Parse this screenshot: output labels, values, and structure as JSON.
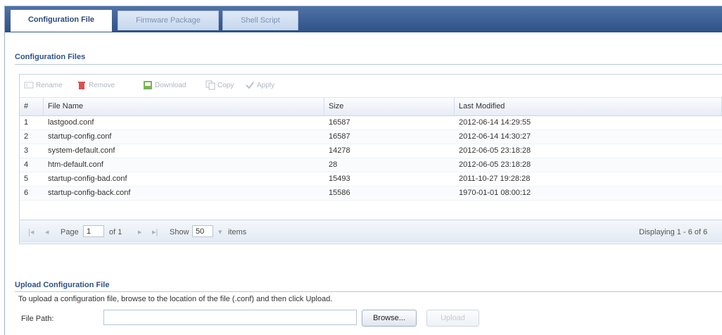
{
  "tabs": [
    {
      "label": "Configuration File",
      "active": true
    },
    {
      "label": "Firmware Package",
      "active": false
    },
    {
      "label": "Shell Script",
      "active": false
    }
  ],
  "config_section": {
    "title": "Configuration Files"
  },
  "toolbar": {
    "rename": "Rename",
    "remove": "Remove",
    "download": "Download",
    "copy": "Copy",
    "apply": "Apply"
  },
  "table": {
    "headers": [
      "#",
      "File Name",
      "Size",
      "Last Modified"
    ],
    "rows": [
      {
        "num": "1",
        "name": "lastgood.conf",
        "size": "16587",
        "modified": "2012-06-14 14:29:55"
      },
      {
        "num": "2",
        "name": "startup-config.conf",
        "size": "16587",
        "modified": "2012-06-14 14:30:27"
      },
      {
        "num": "3",
        "name": "system-default.conf",
        "size": "14278",
        "modified": "2012-06-05 23:18:28"
      },
      {
        "num": "4",
        "name": "htm-default.conf",
        "size": "28",
        "modified": "2012-06-05 23:18:28"
      },
      {
        "num": "5",
        "name": "startup-config-bad.conf",
        "size": "15493",
        "modified": "2011-10-27 19:28:28"
      },
      {
        "num": "6",
        "name": "startup-config-back.conf",
        "size": "15586",
        "modified": "1970-01-01 08:00:12"
      }
    ]
  },
  "pager": {
    "page_label": "Page",
    "page_value": "1",
    "of_label": "of 1",
    "show_label": "Show",
    "show_value": "50",
    "items_label": "items",
    "displaying": "Displaying 1 - 6 of 6"
  },
  "upload_section": {
    "title": "Upload Configuration File",
    "description": "To upload a configuration file, browse to the location of the file (.conf) and then click Upload.",
    "file_path_label": "File Path:",
    "browse_label": "Browse...",
    "upload_label": "Upload"
  },
  "colors": {
    "tab_bar": "#3a5d93",
    "section_title": "#2e5287",
    "remove_icon": "#d9534f",
    "download_icon": "#5a9a3c"
  }
}
